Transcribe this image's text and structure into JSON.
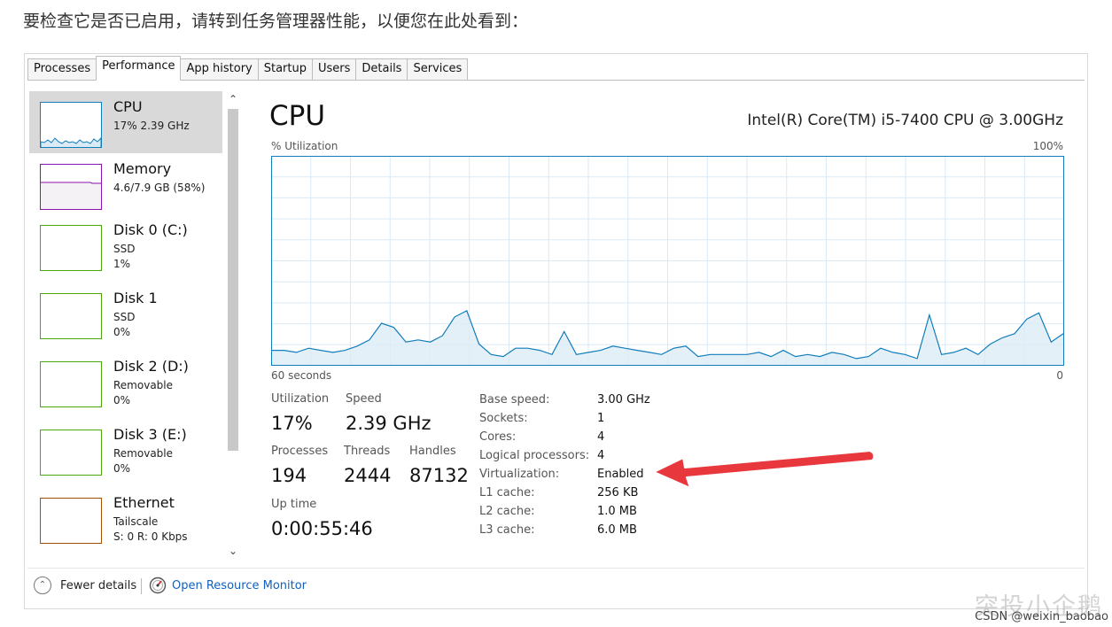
{
  "intro_text": "要检查它是否已启用，请转到任务管理器性能，以便您在此处看到：",
  "tabs": [
    {
      "label": "Processes"
    },
    {
      "label": "Performance"
    },
    {
      "label": "App history"
    },
    {
      "label": "Startup"
    },
    {
      "label": "Users"
    },
    {
      "label": "Details"
    },
    {
      "label": "Services"
    }
  ],
  "active_tab": "Performance",
  "sidebar": {
    "items": [
      {
        "name": "CPU",
        "sub1": "17%  2.39 GHz",
        "sub2": "",
        "color": "#117dbb"
      },
      {
        "name": "Memory",
        "sub1": "4.6/7.9 GB (58%)",
        "sub2": "",
        "color": "#8b12ae"
      },
      {
        "name": "Disk 0 (C:)",
        "sub1": "SSD",
        "sub2": "1%",
        "color": "#4da60c"
      },
      {
        "name": "Disk 1",
        "sub1": "SSD",
        "sub2": "0%",
        "color": "#4da60c"
      },
      {
        "name": "Disk 2 (D:)",
        "sub1": "Removable",
        "sub2": "0%",
        "color": "#4da60c"
      },
      {
        "name": "Disk 3 (E:)",
        "sub1": "Removable",
        "sub2": "0%",
        "color": "#4da60c"
      },
      {
        "name": "Ethernet",
        "sub1": "Tailscale",
        "sub2": "S: 0  R: 0 Kbps",
        "color": "#a74f01"
      }
    ]
  },
  "main": {
    "title": "CPU",
    "model": "Intel(R) Core(TM) i5-7400 CPU @ 3.00GHz",
    "util_label": "% Utilization",
    "util_max": "100%",
    "time_left": "60 seconds",
    "time_right": "0",
    "graph_values": [
      7,
      7,
      6,
      8,
      7,
      6,
      7,
      9,
      12,
      20,
      18,
      11,
      12,
      11,
      14,
      23,
      26,
      10,
      5,
      4,
      8,
      8,
      7,
      5,
      16,
      5,
      6,
      7,
      9,
      8,
      7,
      6,
      5,
      8,
      9,
      4,
      5,
      5,
      5,
      5,
      6,
      4,
      7,
      4,
      5,
      4,
      6,
      5,
      3,
      4,
      8,
      6,
      5,
      3,
      24,
      5,
      6,
      8,
      5,
      10,
      13,
      15,
      22,
      25,
      11,
      15
    ],
    "stats": {
      "utilization_label": "Utilization",
      "utilization": "17%",
      "speed_label": "Speed",
      "speed": "2.39 GHz",
      "processes_label": "Processes",
      "processes": "194",
      "threads_label": "Threads",
      "threads": "2444",
      "handles_label": "Handles",
      "handles": "87132",
      "uptime_label": "Up time",
      "uptime": "0:00:55:46"
    },
    "specs": [
      {
        "label": "Base speed:",
        "value": "3.00 GHz"
      },
      {
        "label": "Sockets:",
        "value": "1"
      },
      {
        "label": "Cores:",
        "value": "4"
      },
      {
        "label": "Logical processors:",
        "value": "4"
      },
      {
        "label": "Virtualization:",
        "value": "Enabled"
      },
      {
        "label": "L1 cache:",
        "value": "256 KB"
      },
      {
        "label": "L2 cache:",
        "value": "1.0 MB"
      },
      {
        "label": "L3 cache:",
        "value": "6.0 MB"
      }
    ]
  },
  "footer": {
    "fewer_details": "Fewer details",
    "open_resource_monitor": "Open Resource Monitor"
  },
  "watermark": {
    "big": "突投小企鹅",
    "small": "CSDN @weixin_baobao"
  },
  "colors": {
    "cpu": "#117dbb",
    "arrow": "#e8383d",
    "link": "#1060c0"
  }
}
